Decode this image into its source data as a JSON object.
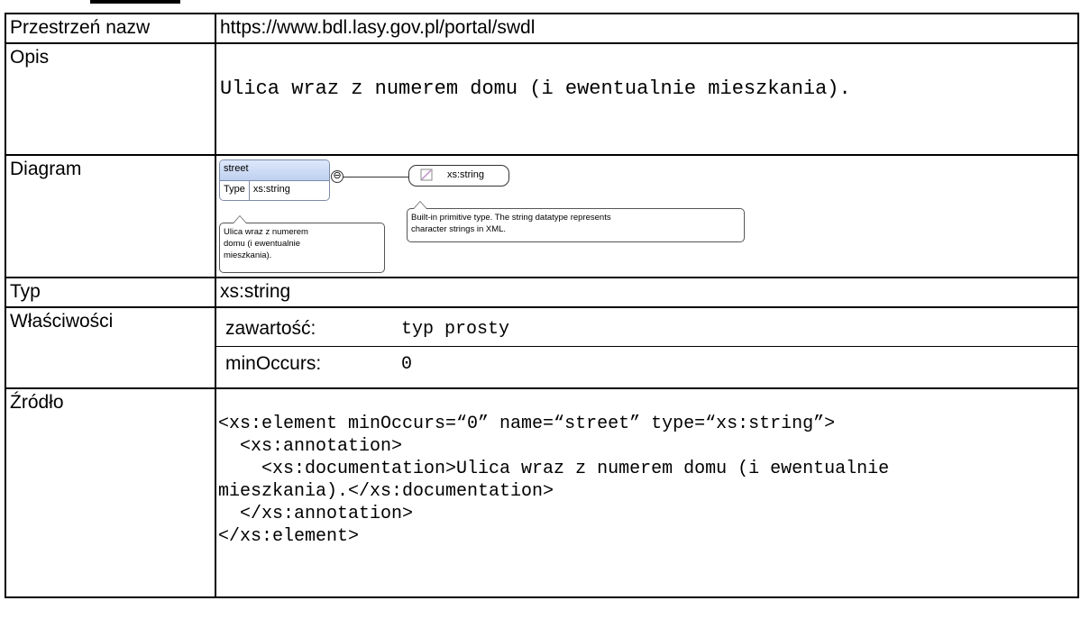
{
  "rows": {
    "namespace": {
      "label": "Przestrzeń nazw",
      "value": "https://www.bdl.lasy.gov.pl/portal/swdl"
    },
    "description": {
      "label": "Opis",
      "value": "Ulica wraz z numerem domu (i ewentualnie mieszkania)."
    },
    "diagram": {
      "label": "Diagram",
      "element_name": "street",
      "type_key": "Type",
      "type_value": "xs:string",
      "seq_symbol": "⊖",
      "simple_type_label": "xs:string",
      "element_tip": "Ulica wraz z numerem\ndomu (i ewentualnie\nmieszkania).",
      "type_tip": "Built-in primitive type. The string datatype represents\ncharacter strings in XML."
    },
    "type": {
      "label": "Typ",
      "value": "xs:string"
    },
    "properties": {
      "label": "Właściwości",
      "items": [
        {
          "key": "zawartość:",
          "value": "typ prosty"
        },
        {
          "key": "minOccurs:",
          "value": "0"
        }
      ]
    },
    "source": {
      "label": "Źródło",
      "code": "<xs:element minOccurs=“0” name=“street” type=“xs:string”>\n  <xs:annotation>\n    <xs:documentation>Ulica wraz z numerem domu (i ewentualnie\nmieszkania).</xs:documentation>\n  </xs:annotation>\n</xs:element>"
    }
  }
}
